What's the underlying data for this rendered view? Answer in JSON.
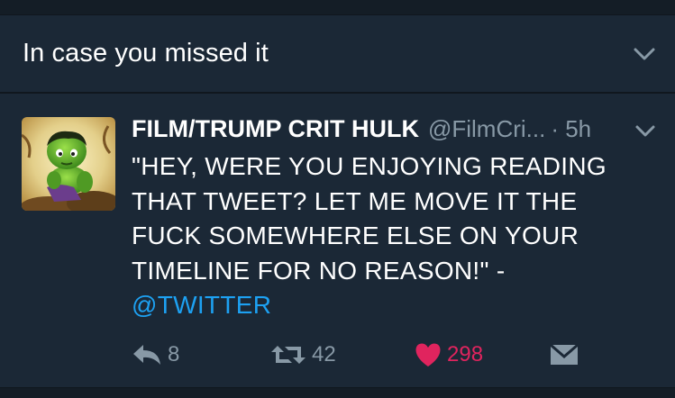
{
  "section": {
    "title": "In case you missed it"
  },
  "tweet": {
    "author_name": "FILM/TRUMP CRIT HULK",
    "handle": "@FilmCri...",
    "time": "· 5h",
    "text_lines": [
      "\"HEY, WERE YOU ENJOYING READING",
      "THAT TWEET? LET ME MOVE IT THE",
      "FUCK SOMEWHERE ELSE ON YOUR",
      "TIMELINE FOR NO REASON!\" -"
    ],
    "mention": "@TWITTER",
    "replies": "8",
    "retweets": "42",
    "likes": "298"
  },
  "colors": {
    "background": "#1b2836",
    "mention": "#1da1f2",
    "like": "#e0245e",
    "muted": "#8899a6"
  },
  "icons": {
    "header": "chevron-down-icon",
    "reply": "reply-icon",
    "retweet": "retweet-icon",
    "like": "heart-icon",
    "dm": "envelope-icon"
  }
}
